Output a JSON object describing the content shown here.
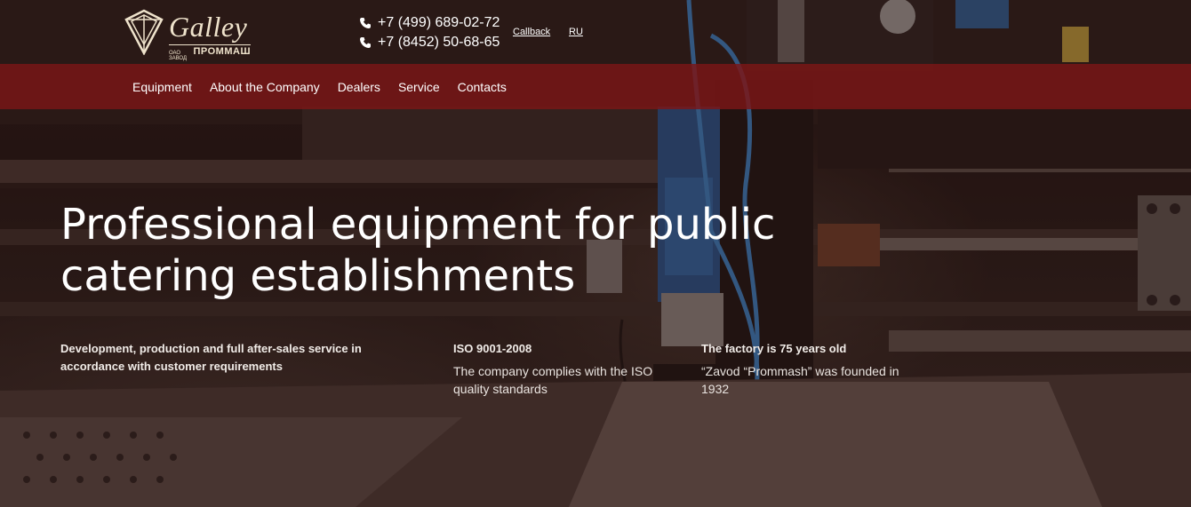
{
  "brand": {
    "name": "Galley",
    "sub_small": "ОАО ЗАВОД",
    "sub_big": "ПРОММАШ"
  },
  "contacts": {
    "phones": [
      "+7 (499) 689-02-72",
      "+7 (8452) 50-68-65"
    ],
    "phone_icon": "phone-icon",
    "callback_label": "Callback",
    "language": "RU"
  },
  "nav": {
    "items": [
      "Equipment",
      "About the Company",
      "Dealers",
      "Service",
      "Contacts"
    ]
  },
  "hero": {
    "headline": "Professional equipment for public catering establishments",
    "features": [
      {
        "title": "Development, production and full after-sales service in accordance with customer requirements",
        "text": ""
      },
      {
        "title": "ISO 9001-2008",
        "text": "The company complies with the ISO quality standards"
      },
      {
        "title": "The factory is 75 years old",
        "text": "“Zavod “Prommash” was founded in 1932"
      }
    ]
  },
  "colors": {
    "nav_background": "#7b1616",
    "text": "#ffffff",
    "logo": "#efe3cc"
  }
}
